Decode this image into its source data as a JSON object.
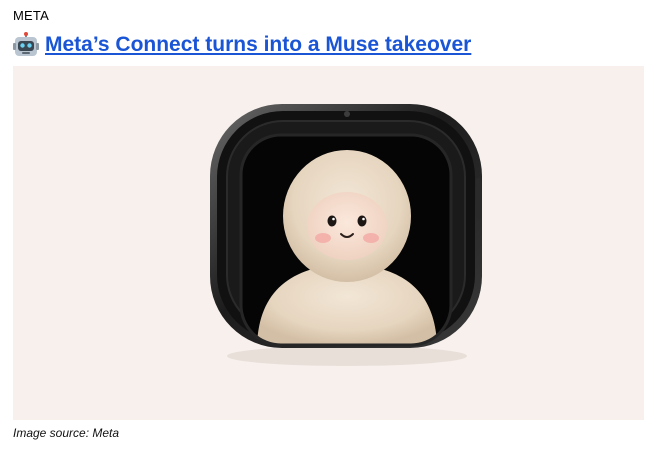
{
  "section": {
    "label": "META"
  },
  "headline": {
    "icon": "robot-face-icon",
    "text": "Meta’s Connect turns into a Muse takeover"
  },
  "hero_image": {
    "subject": "device-with-plush-character-icon",
    "background_color": "#f7f0ed",
    "device_color": "#1b1b1b",
    "character_color": "#e8d8c3"
  },
  "caption": {
    "text": "Image source: Meta"
  }
}
